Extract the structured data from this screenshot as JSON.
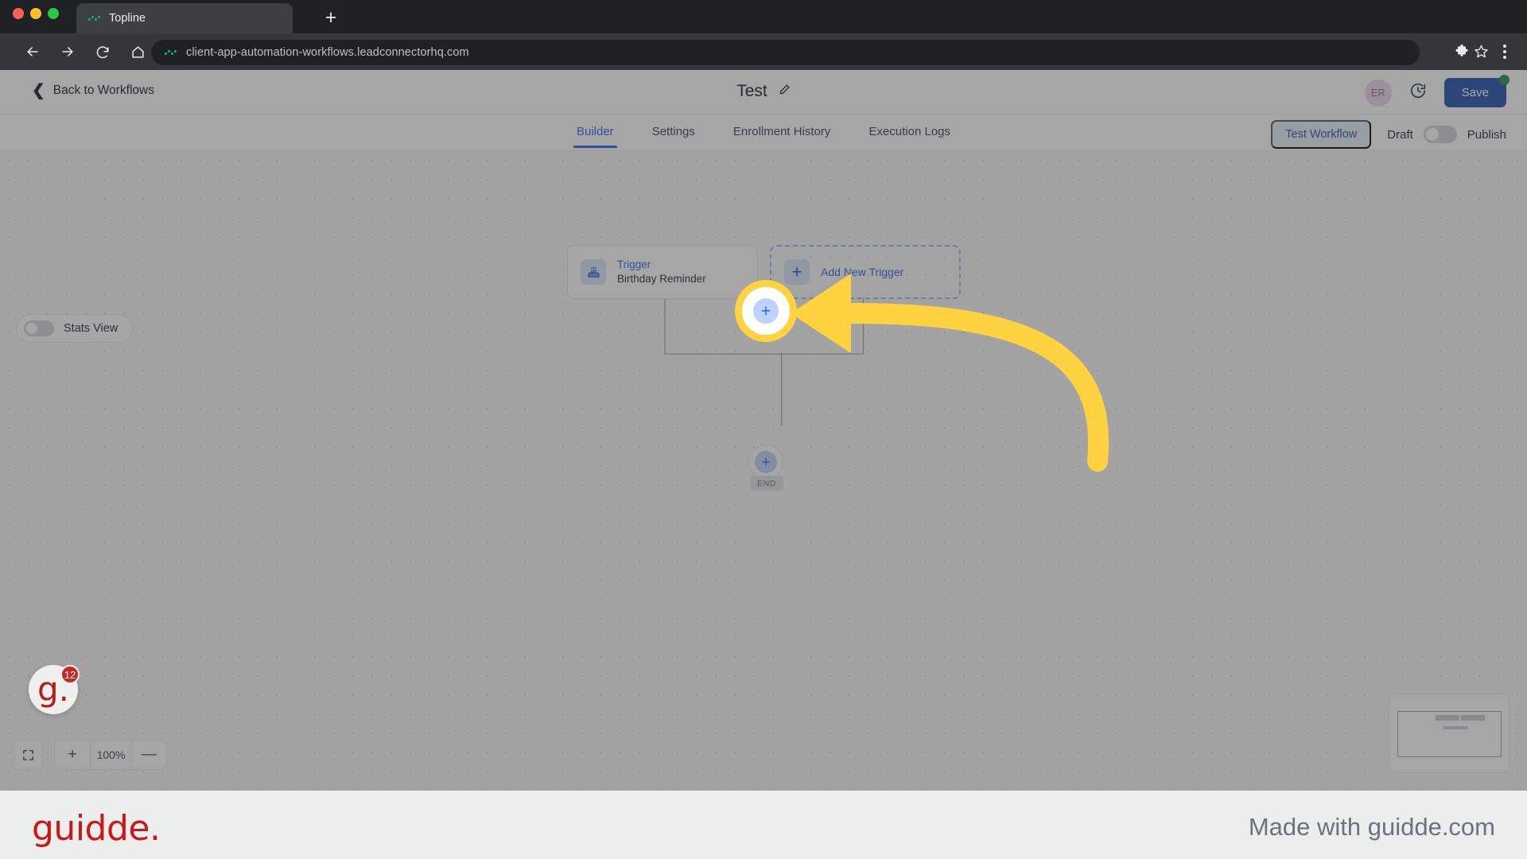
{
  "browser": {
    "tab": {
      "title": "Topline",
      "favicon_icon": "dots-favicon"
    },
    "new_tab_label": "+",
    "nav": {
      "back_icon": "arrow-left-icon",
      "forward_icon": "arrow-right-icon",
      "reload_icon": "reload-icon",
      "home_icon": "home-icon"
    },
    "omnibox": {
      "url": "client-app-automation-workflows.leadconnectorhq.com",
      "site_icon": "dots-favicon"
    },
    "bookmark_icon": "star-icon",
    "extensions_icon": "puzzle-piece-icon",
    "menu_icon": "kebab-menu-icon"
  },
  "app": {
    "back_link": "Back to Workflows",
    "back_icon": "chevron-left-icon",
    "workflow_title": "Test",
    "edit_icon": "pencil-icon",
    "avatar_initials": "ER",
    "history_icon": "clock-history-icon",
    "save_label": "Save",
    "save_status_icon": "green-dot-indicator",
    "tabs": [
      {
        "label": "Builder",
        "active": true
      },
      {
        "label": "Settings",
        "active": false
      },
      {
        "label": "Enrollment History",
        "active": false
      },
      {
        "label": "Execution Logs",
        "active": false
      }
    ],
    "test_workflow_label": "Test Workflow",
    "draft_label": "Draft",
    "publish_label": "Publish",
    "publish_toggle_state": "off"
  },
  "canvas": {
    "stats_view_label": "Stats View",
    "stats_view_state": "off",
    "trigger_node": {
      "kind": "Trigger",
      "name": "Birthday Reminder",
      "icon": "birthday-cake-icon"
    },
    "add_trigger_node": {
      "label": "Add New Trigger",
      "icon": "plus-icon"
    },
    "add_action_button_icon": "plus-icon",
    "end_label": "END",
    "zoom": {
      "fit_icon": "fit-to-screen-icon",
      "zoom_in_label": "+",
      "level": "100%",
      "zoom_out_label": "—"
    },
    "minimap_name": "minimap"
  },
  "overlay": {
    "highlight_target": "add-action-plus-button",
    "arrow_icon": "curved-arrow-left-icon",
    "arrow_color": "#ffd23f",
    "badge_letter": "g.",
    "badge_count": "12"
  },
  "footer": {
    "logo": "guidde.",
    "made_with": "Made with guidde.com"
  },
  "colors": {
    "accent_blue": "#2563eb",
    "save_blue": "#1e4fae",
    "highlight_yellow": "#ffd23f",
    "guidde_red": "#cc1717"
  }
}
